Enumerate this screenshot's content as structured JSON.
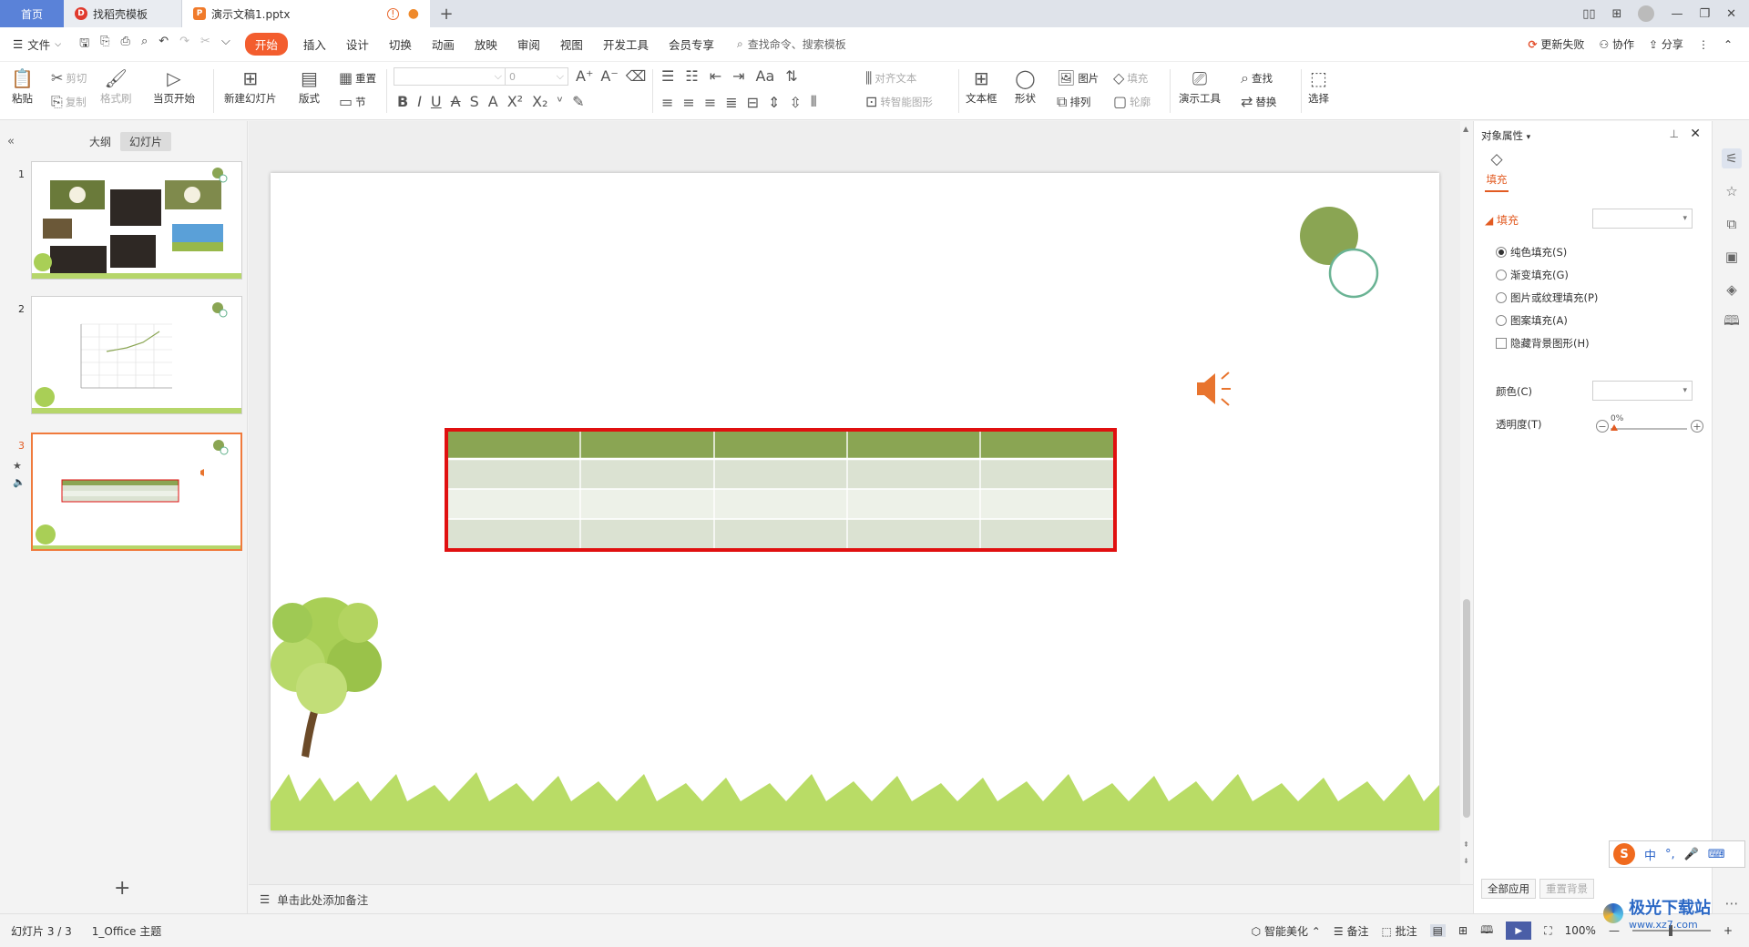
{
  "tabs": {
    "home": "首页",
    "template": "找稻壳模板",
    "document": "演示文稿1.pptx"
  },
  "menubar": {
    "file": "文件",
    "items": [
      "开始",
      "插入",
      "设计",
      "切换",
      "动画",
      "放映",
      "审阅",
      "视图",
      "开发工具",
      "会员专享"
    ],
    "search": "查找命令、搜索模板",
    "update": "更新失败",
    "collab": "协作",
    "share": "分享"
  },
  "ribbon": {
    "paste": "粘贴",
    "cut": "剪切",
    "copy": "复制",
    "format_painter": "格式刷",
    "from_current": "当页开始",
    "new_slide": "新建幻灯片",
    "layout": "版式",
    "reset": "重置",
    "section": "节",
    "font_size": "0",
    "align_text": "对齐文本",
    "convert_smartart": "转智能图形",
    "textbox": "文本框",
    "shape": "形状",
    "picture": "图片",
    "arrange": "排列",
    "fill": "填充",
    "outline": "轮廓",
    "present_tools": "演示工具",
    "find": "查找",
    "replace": "替换",
    "select": "选择"
  },
  "leftpanel": {
    "outline_tab": "大纲",
    "slides_tab": "幻灯片",
    "slide_numbers": [
      "1",
      "2",
      "3"
    ]
  },
  "notes": {
    "placeholder": "单击此处添加备注"
  },
  "rightpane": {
    "title": "对象属性",
    "tab": "填充",
    "section": "填充",
    "options": [
      "纯色填充(S)",
      "渐变填充(G)",
      "图片或纹理填充(P)",
      "图案填充(A)"
    ],
    "hide_bg": "隐藏背景图形(H)",
    "color_label": "颜色(C)",
    "transparency_label": "透明度(T)",
    "transparency_value": "0%",
    "apply_all": "全部应用",
    "reset_bg": "重置背景"
  },
  "statusbar": {
    "slide_info": "幻灯片 3 / 3",
    "theme": "1_Office 主题",
    "smart": "智能美化",
    "notes": "备注",
    "comment": "批注",
    "zoom": "100%"
  },
  "overlay": {
    "ime": "中",
    "brand": "极光下载站",
    "url": "www.xz7.com"
  },
  "colors": {
    "accent": "#f35d2e",
    "table_header": "#8aa553",
    "table_row_dark": "#dbe2d2",
    "table_row_light": "#edf1e8",
    "selection": "#e01010"
  },
  "table": {
    "rows": 4,
    "cols": 5
  }
}
